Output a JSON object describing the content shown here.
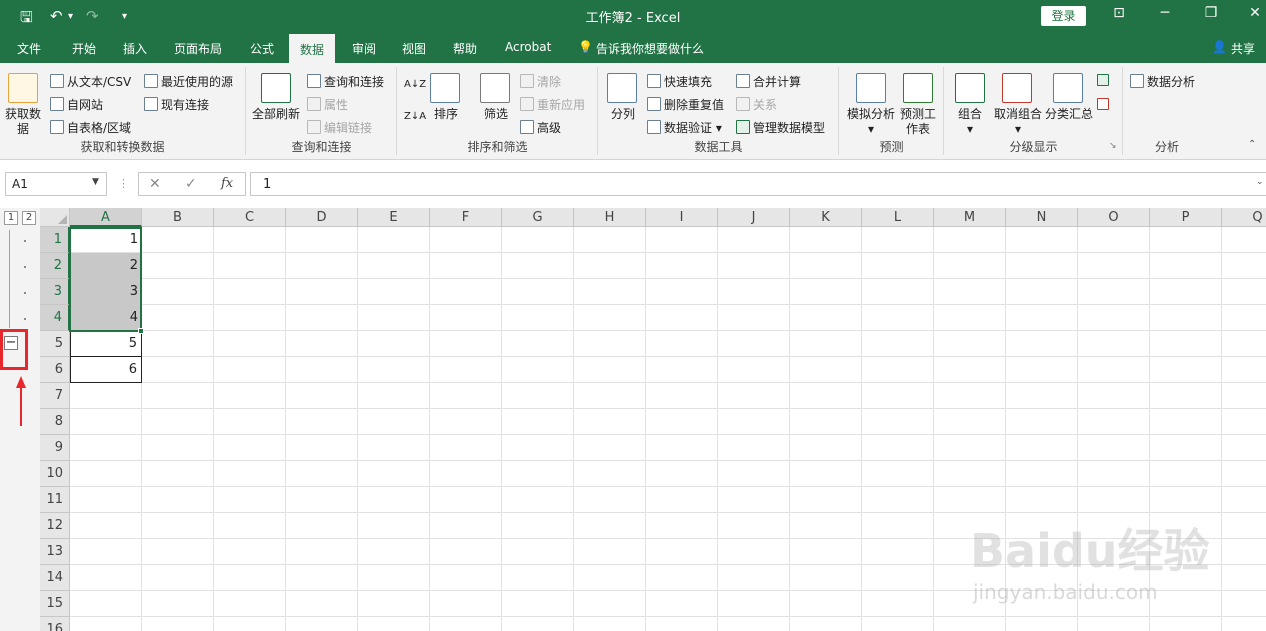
{
  "titlebar": {
    "title": "工作簿2  -  Excel",
    "login": "登录",
    "qa_dropdown": "▾"
  },
  "tabs": [
    "文件",
    "开始",
    "插入",
    "页面布局",
    "公式",
    "数据",
    "审阅",
    "视图",
    "帮助",
    "Acrobat"
  ],
  "active_tab": "数据",
  "tell_me": "告诉我你想要做什么",
  "share": "共享",
  "ribbon": {
    "get_data": {
      "big_label": "获取数据",
      "from_text": "从文本/CSV",
      "from_web": "自网站",
      "from_table": "自表格/区域",
      "recent": "最近使用的源",
      "existing": "现有连接",
      "group": "获取和转换数据"
    },
    "queries": {
      "refresh_all": "全部刷新",
      "queries_conn": "查询和连接",
      "properties": "属性",
      "edit_links": "编辑链接",
      "group": "查询和连接"
    },
    "sort_filter": {
      "sort": "排序",
      "filter": "筛选",
      "clear": "清除",
      "reapply": "重新应用",
      "advanced": "高级",
      "group": "排序和筛选"
    },
    "data_tools": {
      "text_to_col": "分列",
      "flash_fill": "快速填充",
      "remove_dup": "删除重复值",
      "validation": "数据验证",
      "consolidate": "合并计算",
      "relations": "关系",
      "manage_model": "管理数据模型",
      "group": "数据工具"
    },
    "forecast": {
      "what_if": "模拟分析",
      "sheet": "预测工作表",
      "group": "预测"
    },
    "outline": {
      "group_btn": "组合",
      "ungroup": "取消组合",
      "subtotal": "分类汇总",
      "group": "分级显示"
    },
    "analysis": {
      "data_analysis": "数据分析",
      "group": "分析"
    }
  },
  "formula_bar": {
    "name_box": "A1",
    "cancel": "✕",
    "enter": "✓",
    "fx": "fx",
    "value": "1"
  },
  "outline_levels": [
    "1",
    "2"
  ],
  "outline_toggle": "−",
  "columns": [
    "A",
    "B",
    "C",
    "D",
    "E",
    "F",
    "G",
    "H",
    "I",
    "J",
    "K",
    "L",
    "M",
    "N",
    "O",
    "P",
    "Q"
  ],
  "rows": [
    "1",
    "2",
    "3",
    "4",
    "5",
    "6",
    "7",
    "8",
    "9",
    "10",
    "11",
    "12",
    "13",
    "14",
    "15",
    "16"
  ],
  "cells": [
    "1",
    "2",
    "3",
    "4",
    "5",
    "6"
  ],
  "watermark": {
    "logo": "Baidu经验",
    "url": "jingyan.baidu.com"
  }
}
